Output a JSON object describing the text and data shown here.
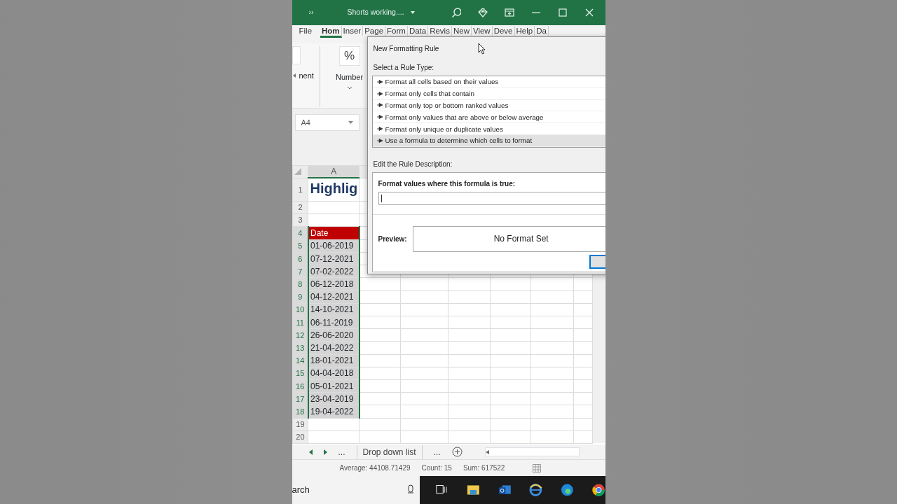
{
  "title_bar": {
    "more": "››",
    "title": "Shorts working...."
  },
  "ribbon_tabs": [
    {
      "label": "File",
      "selected": false
    },
    {
      "label": "Hom",
      "selected": true
    },
    {
      "label": "Inser",
      "selected": false
    },
    {
      "label": "Page",
      "selected": false
    },
    {
      "label": "Form",
      "selected": false
    },
    {
      "label": "Data",
      "selected": false
    },
    {
      "label": "Revis",
      "selected": false
    },
    {
      "label": "New",
      "selected": false
    },
    {
      "label": "View",
      "selected": false
    },
    {
      "label": "Deve",
      "selected": false
    },
    {
      "label": "Help",
      "selected": false
    },
    {
      "label": "Da",
      "selected": false
    }
  ],
  "ribbon_groups": {
    "partial_label": "nent",
    "number_icon": "%",
    "number_label": "Number"
  },
  "name_box": "A4",
  "sheet": {
    "column_header": "A",
    "rows": [
      {
        "number": "1",
        "value": "Highlig",
        "kind": "title",
        "selected": false
      },
      {
        "number": "2",
        "selected": false
      },
      {
        "number": "3",
        "selected": false
      },
      {
        "number": "4",
        "value": "Date",
        "kind": "header",
        "selected": true
      },
      {
        "number": "5",
        "value": "01-06-2019",
        "kind": "date",
        "selected": true
      },
      {
        "number": "6",
        "value": "07-12-2021",
        "kind": "date",
        "selected": true
      },
      {
        "number": "7",
        "value": "07-02-2022",
        "kind": "date",
        "selected": true
      },
      {
        "number": "8",
        "value": "06-12-2018",
        "kind": "date",
        "selected": true
      },
      {
        "number": "9",
        "value": "04-12-2021",
        "kind": "date",
        "selected": true
      },
      {
        "number": "10",
        "value": "14-10-2021",
        "kind": "date",
        "selected": true
      },
      {
        "number": "11",
        "value": "06-11-2019",
        "kind": "date",
        "selected": true
      },
      {
        "number": "12",
        "value": "26-06-2020",
        "kind": "date",
        "selected": true
      },
      {
        "number": "13",
        "value": "21-04-2022",
        "kind": "date",
        "selected": true
      },
      {
        "number": "14",
        "value": "18-01-2021",
        "kind": "date",
        "selected": true
      },
      {
        "number": "15",
        "value": "04-04-2018",
        "kind": "date",
        "selected": true
      },
      {
        "number": "16",
        "value": "05-01-2021",
        "kind": "date",
        "selected": true
      },
      {
        "number": "17",
        "value": "23-04-2019",
        "kind": "date",
        "selected": true
      },
      {
        "number": "18",
        "value": "19-04-2022",
        "kind": "date",
        "selected": true
      },
      {
        "number": "19",
        "selected": false
      },
      {
        "number": "20",
        "selected": false
      }
    ]
  },
  "sheet_tabs": {
    "overflow_left": "...",
    "tab": "Drop down list",
    "overflow_right": "..."
  },
  "status_bar": [
    "Average: 44108.71429",
    "Count: 15",
    "Sum: 617522"
  ],
  "taskbar": {
    "search": "arch"
  },
  "dialog": {
    "title": "New Formatting Rule",
    "rule_type_label": "Select a Rule Type:",
    "rule_types": [
      {
        "label": "Format all cells based on their values",
        "selected": false
      },
      {
        "label": "Format only cells that contain",
        "selected": false
      },
      {
        "label": "Format only top or bottom ranked values",
        "selected": false
      },
      {
        "label": "Format only values that are above or below average",
        "selected": false
      },
      {
        "label": "Format only unique or duplicate values",
        "selected": false
      },
      {
        "label": "Use a formula to determine which cells to format",
        "selected": true
      }
    ],
    "description_label": "Edit the Rule Description:",
    "formula_label": "Format values where this formula is true:",
    "preview_label": "Preview:",
    "preview_text": "No Format Set"
  }
}
